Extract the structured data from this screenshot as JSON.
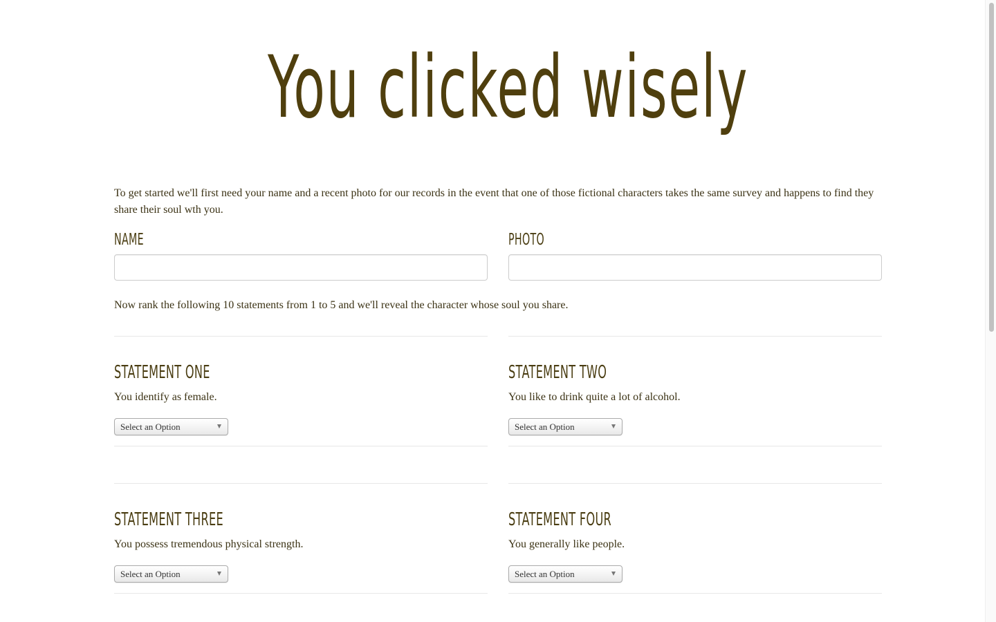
{
  "header": {
    "title": "You clicked wisely"
  },
  "intro": {
    "text": "To get started we'll first need your name and a recent photo for our records in the event that one of those fictional characters takes the same survey and happens to find they share their soul wth you."
  },
  "form": {
    "name_label": "Name",
    "name_value": "",
    "photo_label": "Photo",
    "photo_value": ""
  },
  "instructions": {
    "text": "Now rank the following 10 statements from 1 to 5 and we'll reveal the character whose soul you share."
  },
  "statements": [
    {
      "title": "Statement One",
      "text": "You identify as female.",
      "select": "Select an Option"
    },
    {
      "title": "Statement Two",
      "text": "You like to drink quite a lot of alcohol.",
      "select": "Select an Option"
    },
    {
      "title": "Statement Three",
      "text": "You possess tremendous physical strength.",
      "select": "Select an Option"
    },
    {
      "title": "Statement Four",
      "text": "You generally like people.",
      "select": "Select an Option"
    }
  ],
  "icons": {
    "dropdown": "chevron-down-icon"
  },
  "colors": {
    "heading": "#4f3f0e",
    "body_text": "#3b3214",
    "divider": "#e7e7e7",
    "input_border": "#cccccc"
  }
}
